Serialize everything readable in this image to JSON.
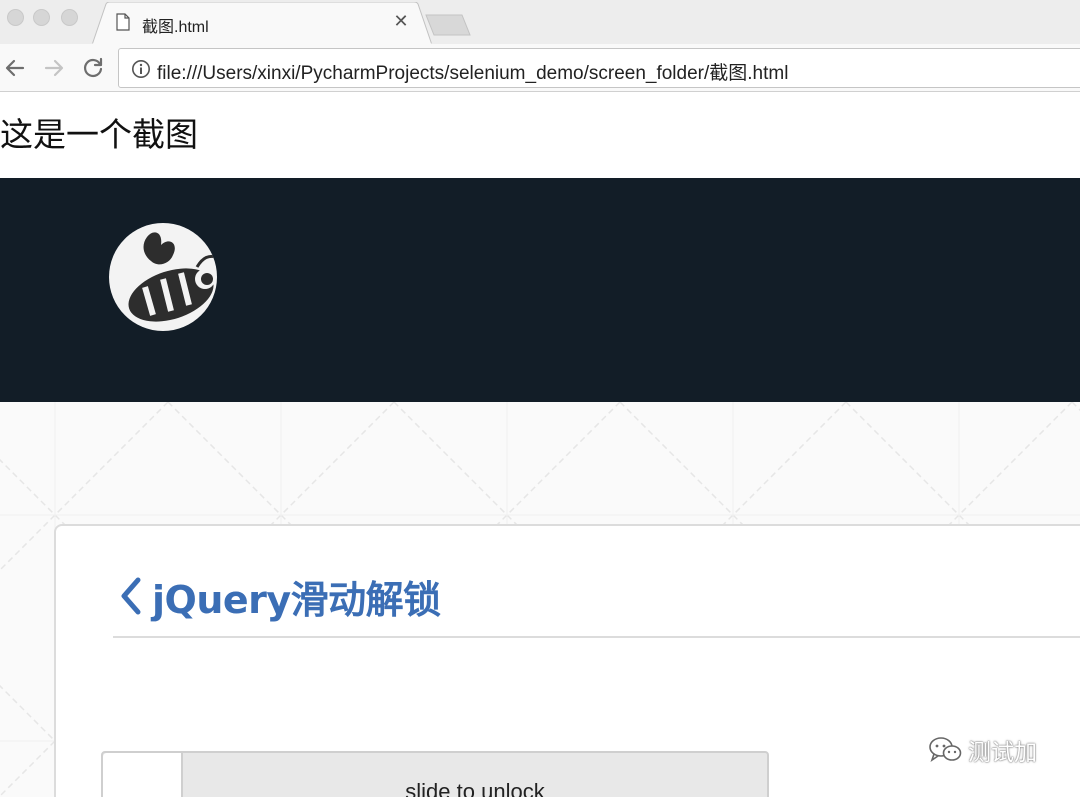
{
  "browser": {
    "tab": {
      "title": "截图.html"
    },
    "address_bar": {
      "url": "file:///Users/xinxi/PycharmProjects/selenium_demo/screen_folder/截图.html"
    }
  },
  "page": {
    "heading": "这是一个截图",
    "card": {
      "title": "jQuery滑动解锁"
    },
    "slider": {
      "label": "slide to unlock"
    }
  },
  "watermark": {
    "text": "测试加"
  },
  "icons": {
    "file": "file-icon",
    "close": "close-icon",
    "back": "back-arrow-icon",
    "forward": "forward-arrow-icon",
    "reload": "reload-icon",
    "info": "info-icon",
    "logo": "bee-logo-icon",
    "chevron": "chevron-left-icon",
    "wechat": "wechat-icon"
  },
  "colors": {
    "header_band": "#121d27",
    "title_blue": "#3b6eb5",
    "slider_track": "#e8e8e8"
  }
}
